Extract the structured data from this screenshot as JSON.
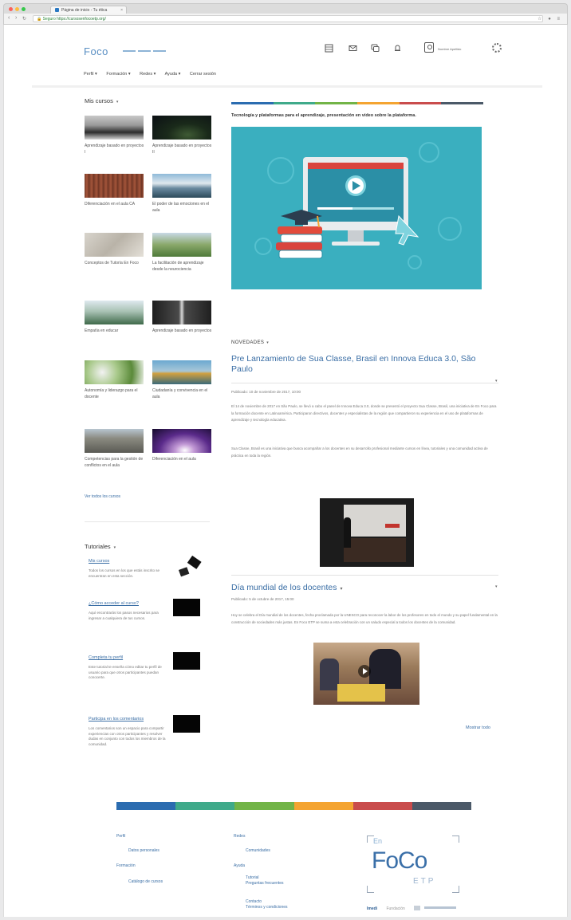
{
  "browser": {
    "tab_title": "Página de inicio - Tu ética",
    "tab_close": "×",
    "url_secure": "Seguro",
    "url_host": "https://cursosenfocoetp.org/",
    "url_path": "",
    "nav_back": "‹",
    "nav_forward": "›",
    "nav_reload": "↻",
    "extension_icons": "☆ ● ≡"
  },
  "header": {
    "logo_text": "Foco",
    "brand_sub": "",
    "user_name": "Nombre Apellido",
    "nav": [
      "Perfil ▾",
      "Formación ▾",
      "Redes ▾",
      "Ayuda ▾",
      "Cerrar sesión"
    ]
  },
  "sidebar": {
    "courses_title": "Mis cursos",
    "courses_caret": "▾",
    "courses": [
      {
        "label": "Aprendizaje basado en proyectos I"
      },
      {
        "label": "Aprendizaje basado en proyectos II"
      },
      {
        "label": "Diferenciación en el aula CA"
      },
      {
        "label": "El poder de las emociones en el aula"
      },
      {
        "label": "Conceptos de Tutoría En Foco"
      },
      {
        "label": "La facilitación de aprendizaje desde la neurociencia"
      },
      {
        "label": "Empatía en educar"
      },
      {
        "label": "Aprendizaje basado en proyectos"
      },
      {
        "label": "Autonomía y liderazgo para el docente"
      },
      {
        "label": "Ciudadanía y convivencia en el aula"
      },
      {
        "label": "Competencias para la gestión de conflictos en el aula"
      },
      {
        "label": "Diferenciación en el aula"
      }
    ],
    "see_all": "Ver todos los cursos",
    "tutorials_title": "Tutoriales",
    "tutorials_caret": "▾",
    "tutorials": [
      {
        "title": "Mis cursos",
        "desc": "Todos los cursos en los que estás inscrito se encuentran en esta sección."
      },
      {
        "title": "¿Cómo acceder al curso?",
        "desc": "Aquí encontrarás los pasos necesarios para ingresar a cualquiera de tus cursos."
      },
      {
        "title": "Completa tu perfil",
        "desc": "Este tutorial te enseña cómo editar tu perfil de usuario para que otros participantes puedan conocerte."
      },
      {
        "title": "Participa en los comentarios",
        "desc": "Los comentarios son un espacio para compartir experiencias con otros participantes y resolver dudas en conjunto con todos los miembros de la comunidad."
      }
    ]
  },
  "main": {
    "banner_text": "Tecnología y plataformas para el aprendizaje, presentación en vídeo sobre la plataforma.",
    "novedades_title": "NOVEDADES",
    "novedades_caret": "▾",
    "posts": [
      {
        "title": "Pre Lanzamiento de Sua Classe, Brasil en Innova Educa 3.0, São Paulo",
        "meta": "Publicado: 10 de noviembre de 2017, 10:00",
        "body_1": "El 14 de noviembre de 2017 en São Paulo, se llevó a cabo el panel de Innova Educa 3.0, donde se presentó el proyecto Sua Classe, Brasil, una iniciativa de En Foco para la formación docente en Latinoamérica. Participaron directivos, docentes y especialistas de la región que compartieron su experiencia en el uso de plataformas de aprendizaje y tecnología educativa.",
        "body_2": "Sua Classe, Brasil es una iniciativa que busca acompañar a los docentes en su desarrollo profesional mediante cursos en línea, tutoriales y una comunidad activa de práctica en toda la región."
      },
      {
        "title": "Día mundial de los docentes",
        "meta": "Publicado: 5 de octubre de 2017, 15:00",
        "body_1": "Hoy se celebra el Día mundial de los docentes, fecha proclamada por la UNESCO para reconocer la labor de los profesores en todo el mundo y su papel fundamental en la construcción de sociedades más justas. En Foco ETP se suma a esta celebración con un saludo especial a todos los docentes de la comunidad."
      }
    ],
    "more_link": "Mostrar todo"
  },
  "footer": {
    "col1": {
      "h1": "Perfil",
      "i1": "Datos personales",
      "h2": "Formación",
      "i2": "Catálogo de cursos"
    },
    "col2": {
      "h1": "Redes",
      "i1": "Comunidades",
      "h2": "Ayuda",
      "i2": "Tutorial",
      "i3": "Preguntas frecuentes",
      "i4": "Contacto",
      "i5": "Términos y condiciones"
    },
    "logo_en": "En",
    "logo_focus": "FoCo",
    "logo_etp": "ETP",
    "partners": "Imedi",
    "partner_2": "Fundación"
  },
  "colors": {
    "accent": "#3a6ea5",
    "bar": [
      "#2b6cb0",
      "#3faa8a",
      "#72b447",
      "#f4a431",
      "#c94c4c",
      "#4b5968"
    ]
  }
}
